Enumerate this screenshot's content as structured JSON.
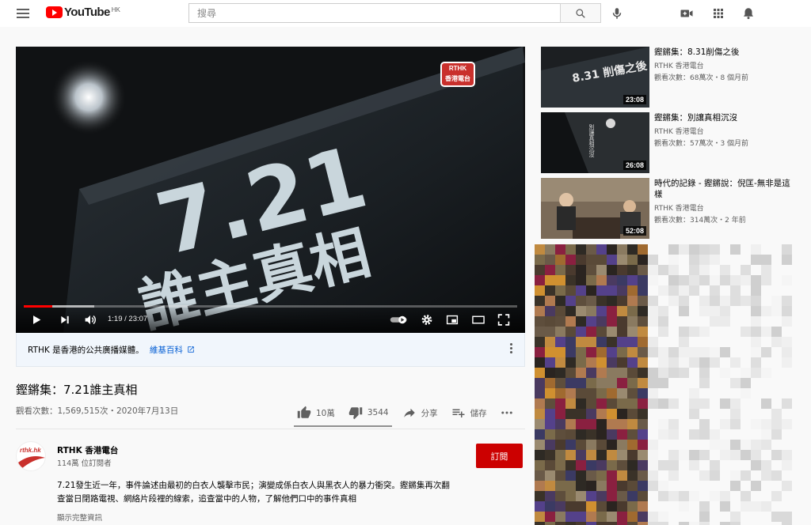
{
  "header": {
    "logo_text": "YouTube",
    "region": "HK",
    "search_placeholder": "搜尋"
  },
  "player": {
    "overlay_logo_line1": "RTHK",
    "overlay_logo_line2": "香港電台",
    "video_text_number": "7.21",
    "video_text_title": "誰主真相",
    "time_display": "1:19 / 23:07",
    "progress": 0.057
  },
  "info_panel": {
    "text": "RTHK 是香港的公共廣播媒體。",
    "link": "維基百科"
  },
  "video": {
    "title": "鏗鏘集：7.21誰主真相",
    "views_date": "觀看次數：1,569,515次・2020年7月13日",
    "likes": "10萬",
    "dislikes": "3544",
    "share_label": "分享",
    "save_label": "儲存",
    "like_ratio": 0.966
  },
  "channel": {
    "avatar_text": "rthk.hk",
    "name": "RTHK 香港電台",
    "subscribers": "114萬 位訂閱者",
    "subscribe_label": "訂閱"
  },
  "description": {
    "text": "7.21發生近一年，事件論述由最初的白衣人襲擊市民；演變成係白衣人與黑衣人的暴力衝突。鏗鏘集再次翻查當日閉路電視、網絡片段裡的線索，追查當中的人物，了解他們口中的事件真相",
    "show_more": "顯示完整資訊"
  },
  "recommendations": [
    {
      "title": "鏗鏘集：8.31削傷之後",
      "channel": "RTHK 香港電台",
      "meta": "觀看次數：68萬次・8 個月前",
      "duration": "23:08",
      "thumb_text": "8.31 削傷之後"
    },
    {
      "title": "鏗鏘集：別讓真相沉沒",
      "channel": "RTHK 香港電台",
      "meta": "觀看次數：57萬次・3 個月前",
      "duration": "26:08",
      "thumb_text": "別讓真相沉沒"
    },
    {
      "title": "時代的記錄 - 鏗鏘說：倪匡-無非是這樣",
      "channel": "RTHK 香港電台",
      "meta": "觀看次數：314萬次・2 年前",
      "duration": "52:08"
    }
  ],
  "colors": {
    "brand_red": "#ff0000",
    "subscribe_red": "#cc0000",
    "link_blue": "#065fd4",
    "info_bg": "#f1f6fc"
  }
}
